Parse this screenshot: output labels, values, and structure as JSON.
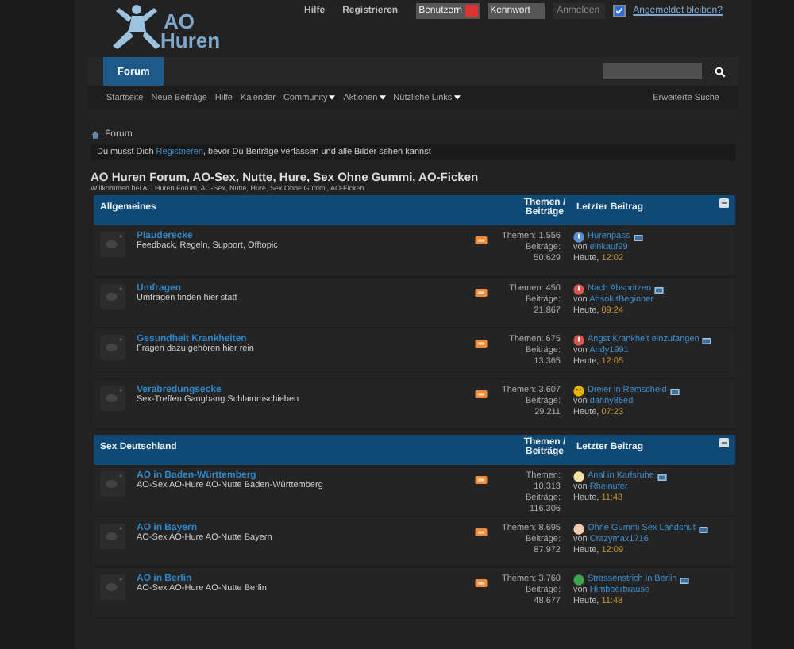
{
  "logo": {
    "line1": "AO",
    "line2": "Huren"
  },
  "top_links": [
    "Hilfe",
    "Registrieren"
  ],
  "login": {
    "username_placeholder": "Benutzern",
    "password_placeholder": "Kennwort",
    "submit": "Anmelden",
    "remember": {
      "label": "Angemeldet bleiben?",
      "checked": true
    }
  },
  "nav_tabs": [
    {
      "label": "Forum",
      "selected": true
    }
  ],
  "subnav": [
    {
      "label": "Startseite",
      "dropdown": false
    },
    {
      "label": "Neue Beiträge",
      "dropdown": false
    },
    {
      "label": "Hilfe",
      "dropdown": false
    },
    {
      "label": "Kalender",
      "dropdown": false
    },
    {
      "label": "Community",
      "dropdown": true
    },
    {
      "label": "Aktionen",
      "dropdown": true
    },
    {
      "label": "Nützliche Links",
      "dropdown": true
    }
  ],
  "advanced_search": "Erweiterte Suche",
  "breadcrumb": "Forum",
  "notice": {
    "before": "Du musst Dich ",
    "link": "Registrieren",
    "after": ", bevor Du Beiträge verfassen und alle Bilder sehen kannst"
  },
  "title": "AO Huren Forum, AO-Sex, Nutte, Hure, Sex Ohne Gummi, AO-Ficken",
  "subtitle": "Willkommen bei AO Huren Forum, AO-Sex, Nutte, Hure, Sex Ohne Gummi, AO-Ficken.",
  "sections": [
    {
      "name": "Allgemeines",
      "stats_heading": "Themen / Beiträge",
      "last_heading": "Letzter Beitrag",
      "forums": [
        {
          "title": "Plauderecke",
          "description": "Feedback, Regeln, Support, Offtopic",
          "stats": [
            "Themen: 1.556",
            "Beiträge:",
            "50.629"
          ],
          "last": {
            "kind": "info",
            "title": "Hurenpass",
            "by": "von",
            "user": "einkauf99",
            "day": "Heute,",
            "time": "12:02"
          }
        },
        {
          "title": "Umfragen",
          "description": "Umfragen finden hier statt",
          "stats": [
            "Themen: 450",
            "Beiträge:",
            "21.867"
          ],
          "last": {
            "kind": "alert",
            "title": "Nach Abspritzen",
            "by": "von",
            "user": "AbsolutBeginner",
            "day": "Heute,",
            "time": "09:24"
          }
        },
        {
          "title": "Gesundheit Krankheiten",
          "description": "Fragen dazu gehören hier rein",
          "stats": [
            "Themen: 675",
            "Beiträge:",
            "13.365"
          ],
          "last": {
            "kind": "alert",
            "title": "Angst Krankheit einzufangen",
            "by": "von",
            "user": "Andy1991",
            "day": "Heute,",
            "time": "12:05"
          }
        },
        {
          "title": "Verabredungsecke",
          "description": "Sex-Treffen Gangbang Schlammschieben",
          "stats": [
            "Themen: 3.607",
            "Beiträge:",
            "29.211"
          ],
          "last": {
            "kind": "smile",
            "title": "Dreier in Remscheid",
            "by": "von",
            "user": "danny86ed",
            "day": "Heute,",
            "time": "07:23"
          }
        }
      ]
    },
    {
      "name": "Sex Deutschland",
      "stats_heading": "Themen / Beiträge",
      "last_heading": "Letzter Beitrag",
      "forums": [
        {
          "title": "AO in Baden-Württemberg",
          "description": "AO-Sex AO-Hure AO-Nutte Baden-Württemberg",
          "stats": [
            "Themen:",
            "10.313",
            "Beiträge:",
            "116.306"
          ],
          "last": {
            "kind": "idea",
            "title": "Anal in Karlsruhe",
            "by": "von",
            "user": "Rheinufer",
            "day": "Heute,",
            "time": "11:43"
          }
        },
        {
          "title": "AO in Bayern",
          "description": "AO-Sex AO-Hure AO-Nutte Bayern",
          "stats": [
            "Themen: 8.695",
            "Beiträge:",
            "87.972"
          ],
          "last": {
            "kind": "hand",
            "title": "Ohne Gummi Sex Landshut",
            "by": "von",
            "user": "Crazymax1716",
            "day": "Heute,",
            "time": "12:09"
          }
        },
        {
          "title": "AO in Berlin",
          "description": "AO-Sex AO-Hure AO-Nutte Berlin",
          "stats": [
            "Themen: 3.760",
            "Beiträge:",
            "48.677"
          ],
          "last": {
            "kind": "cycle",
            "title": "Strassenstrich in Berlin",
            "by": "von",
            "user": "Himbeerbrause",
            "day": "Heute,",
            "time": "11:48"
          }
        }
      ]
    }
  ]
}
